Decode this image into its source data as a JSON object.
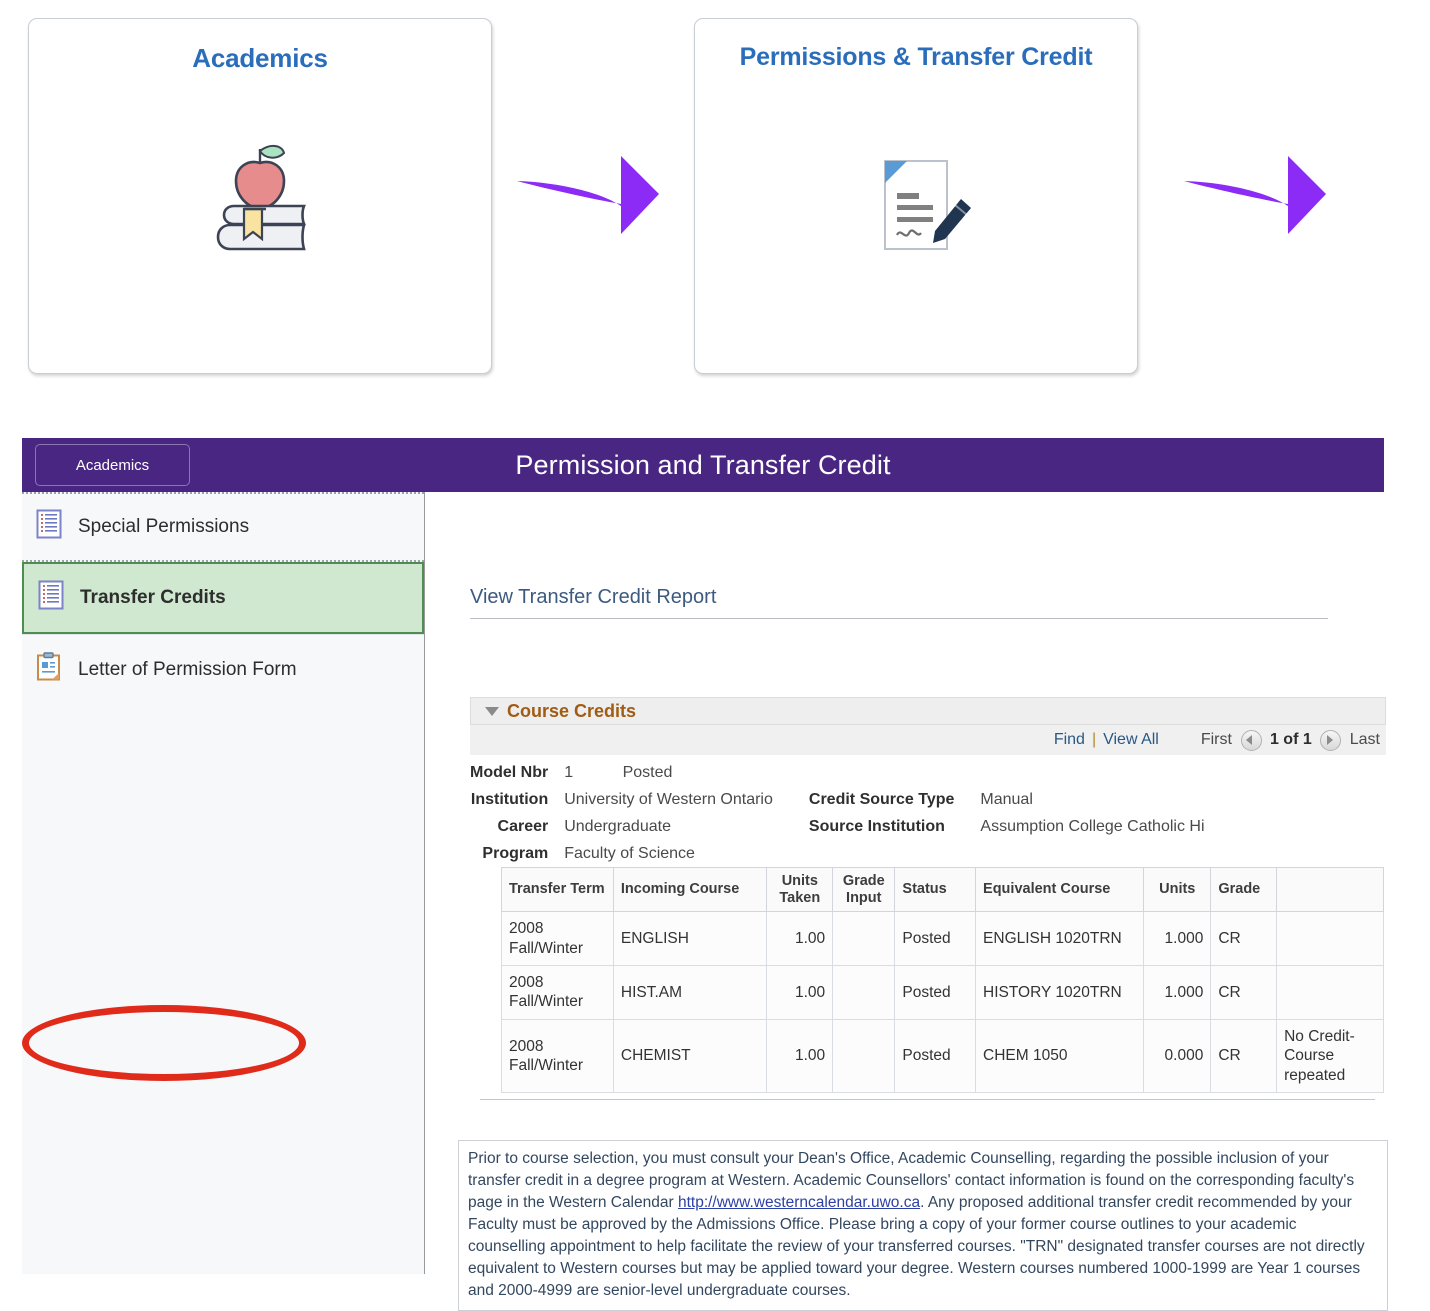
{
  "tiles": [
    {
      "title": "Academics",
      "icon": "apple-on-books-icon"
    },
    {
      "title": "Permissions & Transfer Credit",
      "icon": "signed-document-icon"
    }
  ],
  "arrows": {
    "count": 2,
    "color": "#8B2BF5",
    "icon": "curved-right-arrow-icon"
  },
  "ps": {
    "header": {
      "tab_label": "Academics",
      "title": "Permission and Transfer Credit",
      "bar_color": "#4A2683"
    },
    "sidebar": {
      "items": [
        {
          "label": "Special Permissions",
          "icon": "list-document-icon",
          "selected": false
        },
        {
          "label": "Transfer Credits",
          "icon": "list-document-icon",
          "selected": true
        },
        {
          "label": "Letter of Permission Form",
          "icon": "clipboard-form-icon",
          "selected": false
        }
      ],
      "highlight_color": "#E02B1A",
      "selected_bg": "#CFE8CF"
    },
    "main": {
      "page_heading": "View Transfer Credit Report",
      "group_header": "Course Credits",
      "group_header_color": "#A05C14",
      "pager": {
        "find": "Find",
        "separator": "|",
        "view_all": "View All",
        "first": "First",
        "count": "1 of 1",
        "last": "Last",
        "prev_icon": "left-triangle-icon",
        "next_icon": "right-triangle-icon"
      },
      "model_info": {
        "model_nbr_label": "Model Nbr",
        "model_nbr_value": "1",
        "model_status": "Posted",
        "rows": [
          {
            "label": "Institution",
            "value": "University of Western Ontario",
            "label2": "Credit Source Type",
            "value2": "Manual"
          },
          {
            "label": "Career",
            "value": "Undergraduate",
            "label2": "Source Institution",
            "value2": "Assumption College Catholic Hi"
          },
          {
            "label": "Program",
            "value": "Faculty of Science",
            "label2": "",
            "value2": ""
          }
        ]
      },
      "table": {
        "columns": [
          "Transfer Term",
          "Incoming Course",
          "Units Taken",
          "Grade Input",
          "Status",
          "Equivalent Course",
          "Units",
          "Grade",
          ""
        ],
        "rows": [
          {
            "transfer_term": "2008 Fall/Winter",
            "incoming_course": "ENGLISH",
            "units_taken": "1.00",
            "grade_input": "",
            "status": "Posted",
            "equivalent_course": "ENGLISH 1020TRN",
            "units": "1.000",
            "grade": "CR",
            "note": ""
          },
          {
            "transfer_term": "2008 Fall/Winter",
            "incoming_course": "HIST.AM",
            "units_taken": "1.00",
            "grade_input": "",
            "status": "Posted",
            "equivalent_course": "HISTORY 1020TRN",
            "units": "1.000",
            "grade": "CR",
            "note": ""
          },
          {
            "transfer_term": "2008 Fall/Winter",
            "incoming_course": "CHEMIST",
            "units_taken": "1.00",
            "grade_input": "",
            "status": "Posted",
            "equivalent_course": "CHEM 1050",
            "units": "0.000",
            "grade": "CR",
            "note": "No Credit-Course repeated"
          }
        ]
      },
      "disclaimer": {
        "part1": "Prior to course selection, you must consult your Dean's Office, Academic Counselling, regarding the possible inclusion of your transfer credit in a degree program at Western. Academic Counsellors' contact information is found on the corresponding faculty's page in the Western Calendar ",
        "link_text": "http://www.westerncalendar.uwo.ca",
        "part2": ". Any proposed additional transfer credit recommended by your Faculty must be approved by the Admissions Office. Please bring a copy of your former course outlines to your academic counselling appointment to help facilitate the review of your transferred courses. \"TRN\" designated transfer courses are not directly equivalent to Western courses but may be applied toward your degree. Western courses numbered 1000-1999 are Year 1 courses and 2000-4999 are senior-level undergraduate courses."
      }
    }
  }
}
